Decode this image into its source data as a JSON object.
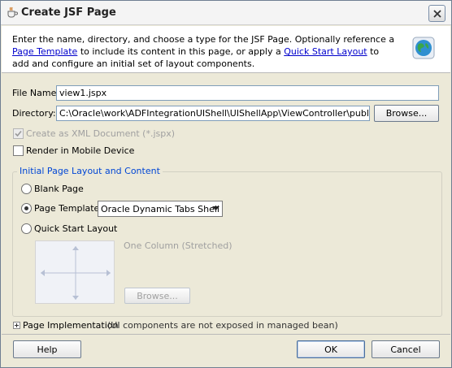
{
  "window": {
    "title": "Create JSF Page"
  },
  "header": {
    "text_1": "Enter the name, directory, and choose a type for the JSF Page. Optionally reference a ",
    "link_page_template": "Page Template",
    "text_2": " to include its content in this page, or apply a ",
    "link_quick_start": "Quick Start Layout",
    "text_3": " to add and configure an initial set of layout components."
  },
  "form": {
    "file_name_label": "File Name:",
    "file_name_value": "view1.jspx",
    "directory_label": "Directory:",
    "directory_value": "C:\\Oracle\\work\\ADFIntegrationUIShell\\UIShellApp\\ViewController\\public_html",
    "browse_label": "Browse...",
    "xml_doc_label": "Create as XML Document (*.jspx)",
    "xml_doc_checked": true,
    "mobile_label": "Render in Mobile Device",
    "mobile_checked": false
  },
  "layout_group": {
    "title": "Initial Page Layout and Content",
    "blank_page_label": "Blank Page",
    "page_template_label": "Page Template",
    "page_template_selected": "Oracle Dynamic Tabs Shell",
    "quick_start_label": "Quick Start Layout",
    "layout_name": "One Column (Stretched)",
    "browse_label": "Browse...",
    "selected_option": "page_template"
  },
  "implementation": {
    "label": "Page Implementation",
    "note": " (UI components are not exposed in managed bean)"
  },
  "buttons": {
    "help": "Help",
    "ok": "OK",
    "cancel": "Cancel"
  },
  "icons": {
    "title": "coffee-cup-icon",
    "header": "globe-icon",
    "close": "close-icon"
  },
  "colors": {
    "link": "#0000cc",
    "group_title": "#0046d5",
    "dialog_bg": "#ece9d8"
  }
}
